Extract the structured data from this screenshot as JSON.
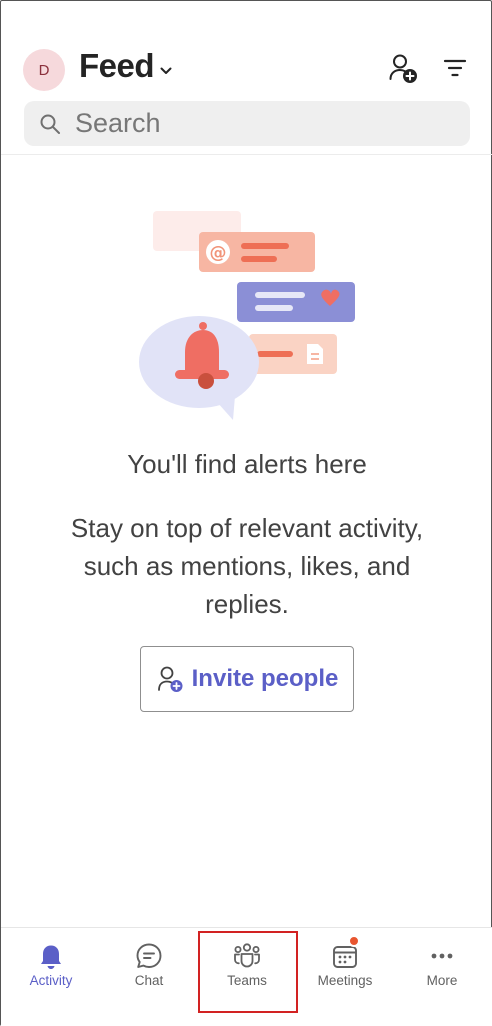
{
  "header": {
    "avatar_initial": "D",
    "title": "Feed",
    "icons": [
      "add-person-icon",
      "filter-icon"
    ]
  },
  "search": {
    "placeholder": "Search"
  },
  "empty_state": {
    "title": "You'll find alerts here",
    "description": "Stay on top of relevant activity, such as mentions, likes, and replies.",
    "invite_label": "Invite people"
  },
  "nav": {
    "items": [
      {
        "label": "Activity",
        "icon": "bell-icon",
        "active": true
      },
      {
        "label": "Chat",
        "icon": "chat-icon",
        "active": false
      },
      {
        "label": "Teams",
        "icon": "teams-icon",
        "active": false,
        "highlighted": true
      },
      {
        "label": "Meetings",
        "icon": "calendar-icon",
        "active": false,
        "badge": true
      },
      {
        "label": "More",
        "icon": "more-icon",
        "active": false
      }
    ]
  },
  "colors": {
    "accent": "#5b5fc7",
    "badge": "#e8552f",
    "highlight_box": "#d22222",
    "avatar_bg": "#f6d9dc"
  }
}
